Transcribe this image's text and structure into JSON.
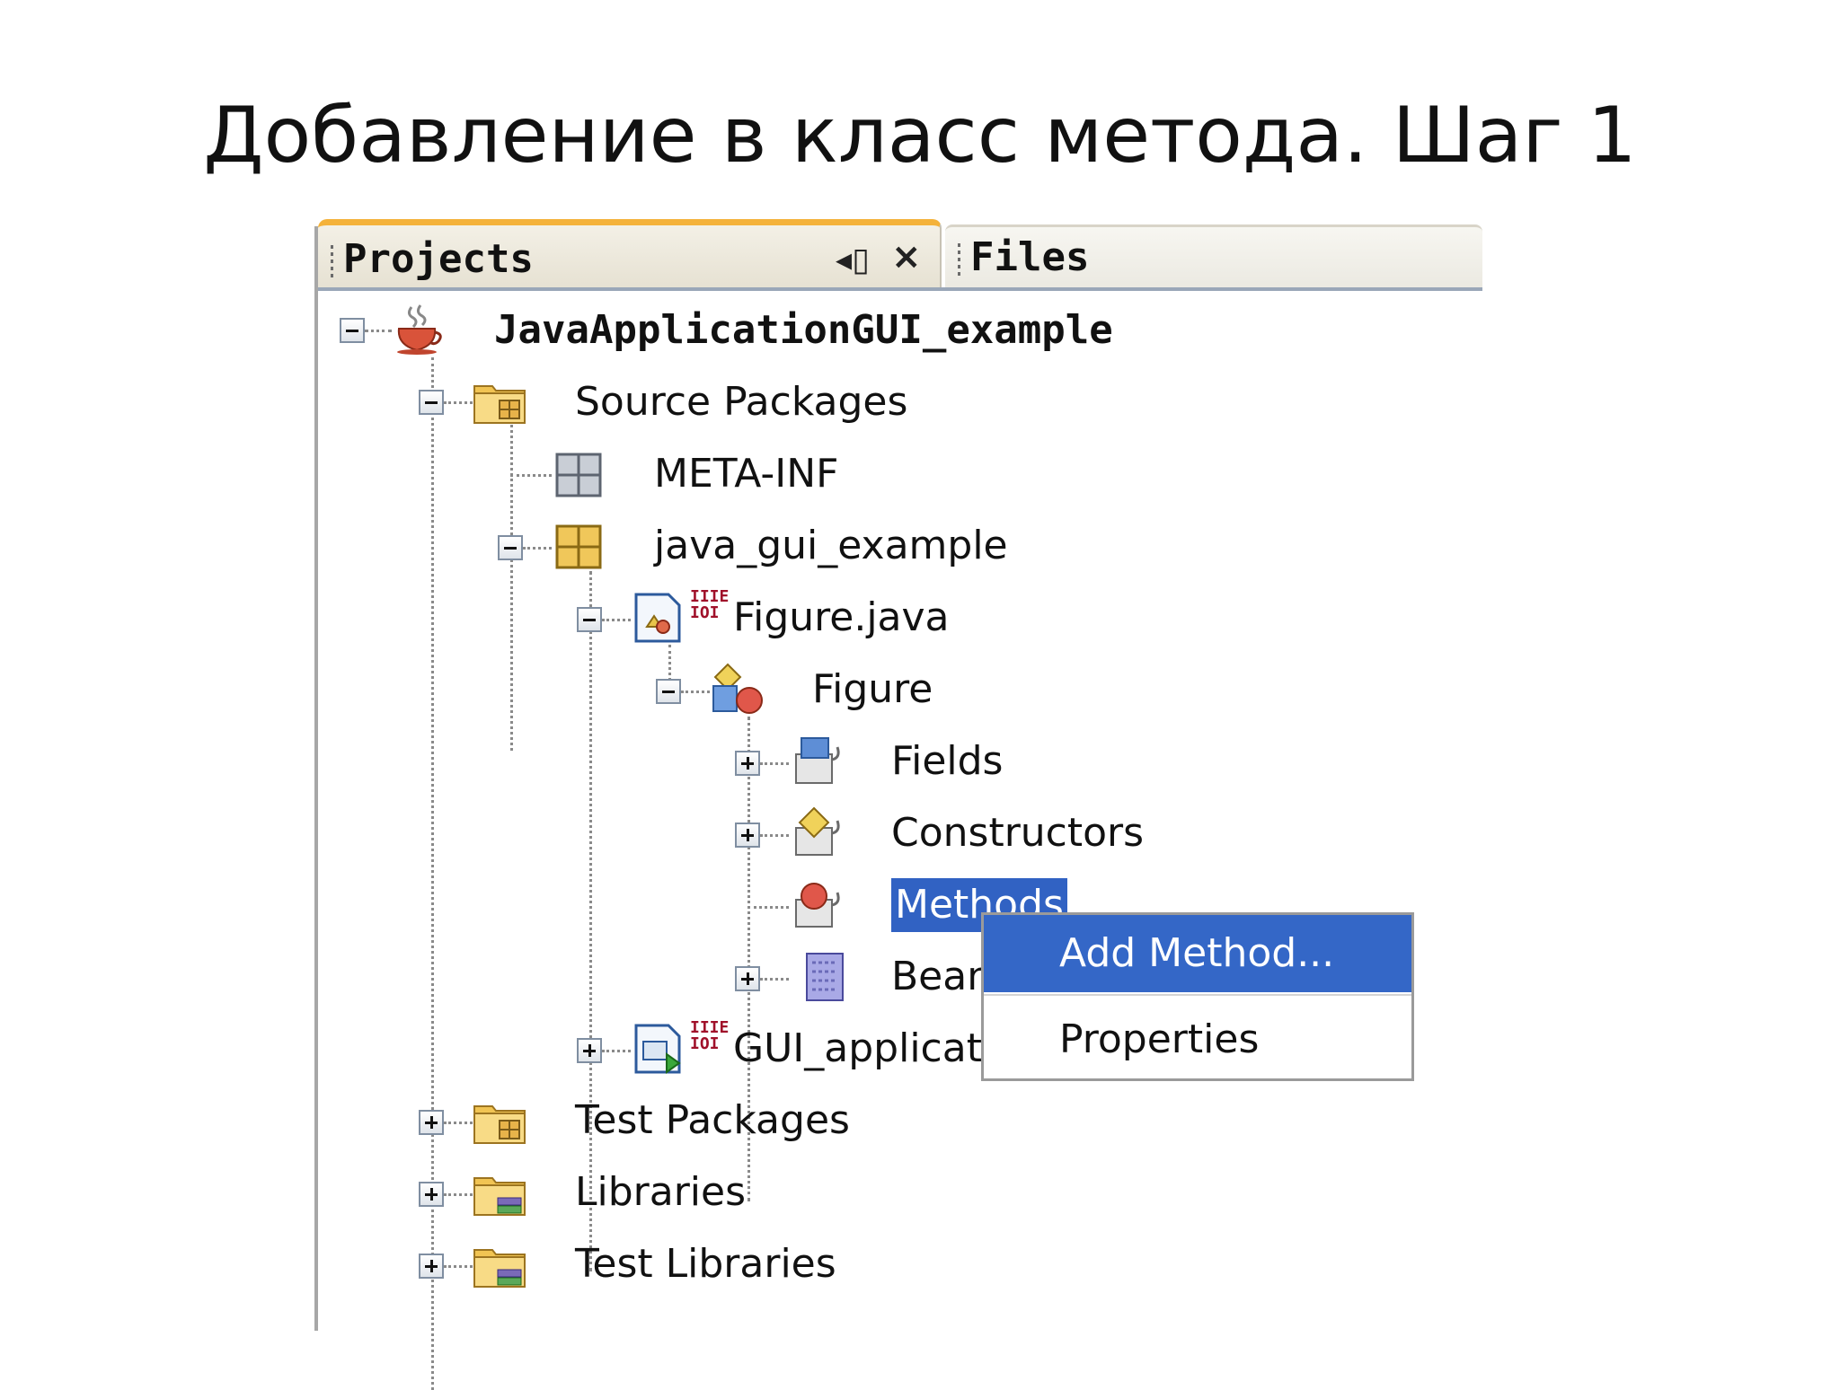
{
  "slide": {
    "title": "Добавление в класс метода. Шаг 1"
  },
  "tabs": {
    "projects_label": "Projects",
    "files_label": "Files",
    "minimize_glyph": "◂▯",
    "close_glyph": "×"
  },
  "tree": {
    "root": "JavaApplicationGUI_example",
    "source_packages": "Source Packages",
    "meta_inf": "META-INF",
    "package": "java_gui_example",
    "figure_java": "Figure.java",
    "figure_class": "Figure",
    "fields": "Fields",
    "constructors": "Constructors",
    "methods": "Methods",
    "bean": "Bean",
    "gui_app": "GUI_applicat",
    "test_packages": "Test Packages",
    "libraries": "Libraries",
    "test_libraries": "Test Libraries",
    "badge": "IIIE\nIOI"
  },
  "context_menu": {
    "items": [
      "Add Method...",
      "Properties"
    ]
  },
  "colors": {
    "selection": "#3162c3",
    "tab_accent": "#f4b23a",
    "badge": "#a0112a"
  }
}
